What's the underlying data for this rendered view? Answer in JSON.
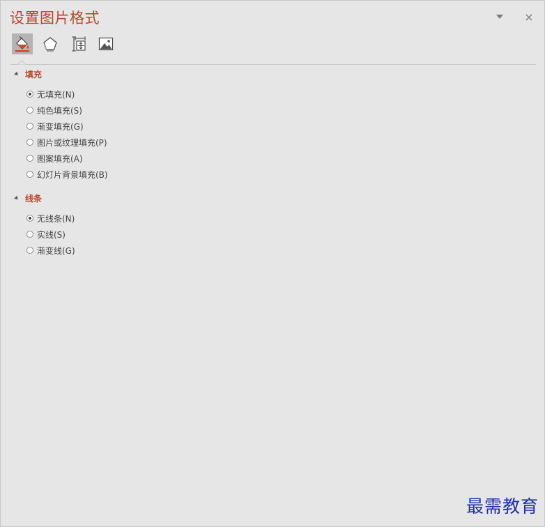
{
  "pane": {
    "title": "设置图片格式",
    "dropdown_icon": "chevron-down-icon",
    "close_label": "×"
  },
  "toolbar": {
    "tabs": [
      {
        "icon": "fill-line-icon",
        "active": true
      },
      {
        "icon": "effects-pentagon-icon",
        "active": false
      },
      {
        "icon": "size-properties-icon",
        "active": false
      },
      {
        "icon": "picture-icon",
        "active": false
      }
    ]
  },
  "sections": {
    "fill": {
      "header": "填充",
      "options": [
        {
          "label": "无填充(N)",
          "checked": true
        },
        {
          "label": "纯色填充(S)",
          "checked": false
        },
        {
          "label": "渐变填充(G)",
          "checked": false
        },
        {
          "label": "图片或纹理填充(P)",
          "checked": false
        },
        {
          "label": "图案填充(A)",
          "checked": false
        },
        {
          "label": "幻灯片背景填充(B)",
          "checked": false
        }
      ]
    },
    "line": {
      "header": "线条",
      "options": [
        {
          "label": "无线条(N)",
          "checked": true
        },
        {
          "label": "实线(S)",
          "checked": false
        },
        {
          "label": "渐变线(G)",
          "checked": false
        }
      ]
    }
  },
  "watermark": "最需教育",
  "colors": {
    "accent": "#b7472a",
    "background": "#e6e6e6",
    "watermark": "#1f2fa8"
  }
}
